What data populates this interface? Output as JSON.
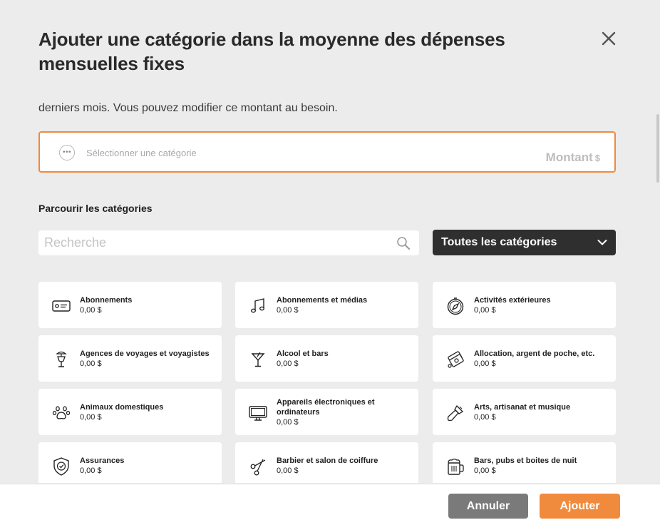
{
  "dialog": {
    "title": "Ajouter une catégorie dans la moyenne des dépenses mensuelles fixes",
    "description": "derniers mois. Vous pouvez modifier ce montant au besoin.",
    "selector": {
      "placeholder": "Sélectionner une catégorie",
      "amount_label": "Montant",
      "currency": "$"
    },
    "browse_heading": "Parcourir les catégories",
    "search": {
      "placeholder": "Recherche"
    },
    "filter": {
      "selected": "Toutes les catégories"
    },
    "categories": [
      {
        "name": "Abonnements",
        "amount": "0,00 $",
        "icon": "card-icon"
      },
      {
        "name": "Abonnements et médias",
        "amount": "0,00 $",
        "icon": "music-note-icon"
      },
      {
        "name": "Activités extérieures",
        "amount": "0,00 $",
        "icon": "compass-icon"
      },
      {
        "name": "Agences de voyages et voyagistes",
        "amount": "0,00 $",
        "icon": "cocktail-umbrella-icon"
      },
      {
        "name": "Alcool et bars",
        "amount": "0,00 $",
        "icon": "martini-icon"
      },
      {
        "name": "Allocation, argent de poche, etc.",
        "amount": "0,00 $",
        "icon": "money-icon"
      },
      {
        "name": "Animaux domestiques",
        "amount": "0,00 $",
        "icon": "paw-icon"
      },
      {
        "name": "Appareils électroniques et ordinateurs",
        "amount": "0,00 $",
        "icon": "monitor-icon"
      },
      {
        "name": "Arts, artisanat et musique",
        "amount": "0,00 $",
        "icon": "paintbrush-icon"
      },
      {
        "name": "Assurances",
        "amount": "0,00 $",
        "icon": "shield-check-icon"
      },
      {
        "name": "Barbier et salon de coiffure",
        "amount": "0,00 $",
        "icon": "scissors-icon"
      },
      {
        "name": "Bars, pubs et boites de nuit",
        "amount": "0,00 $",
        "icon": "beer-mug-icon"
      }
    ],
    "buttons": {
      "cancel": "Annuler",
      "add": "Ajouter"
    },
    "colors": {
      "accent": "#f08a3c",
      "dark": "#2f2f2f",
      "cancel": "#7a7a7a",
      "background": "#ececec"
    }
  }
}
